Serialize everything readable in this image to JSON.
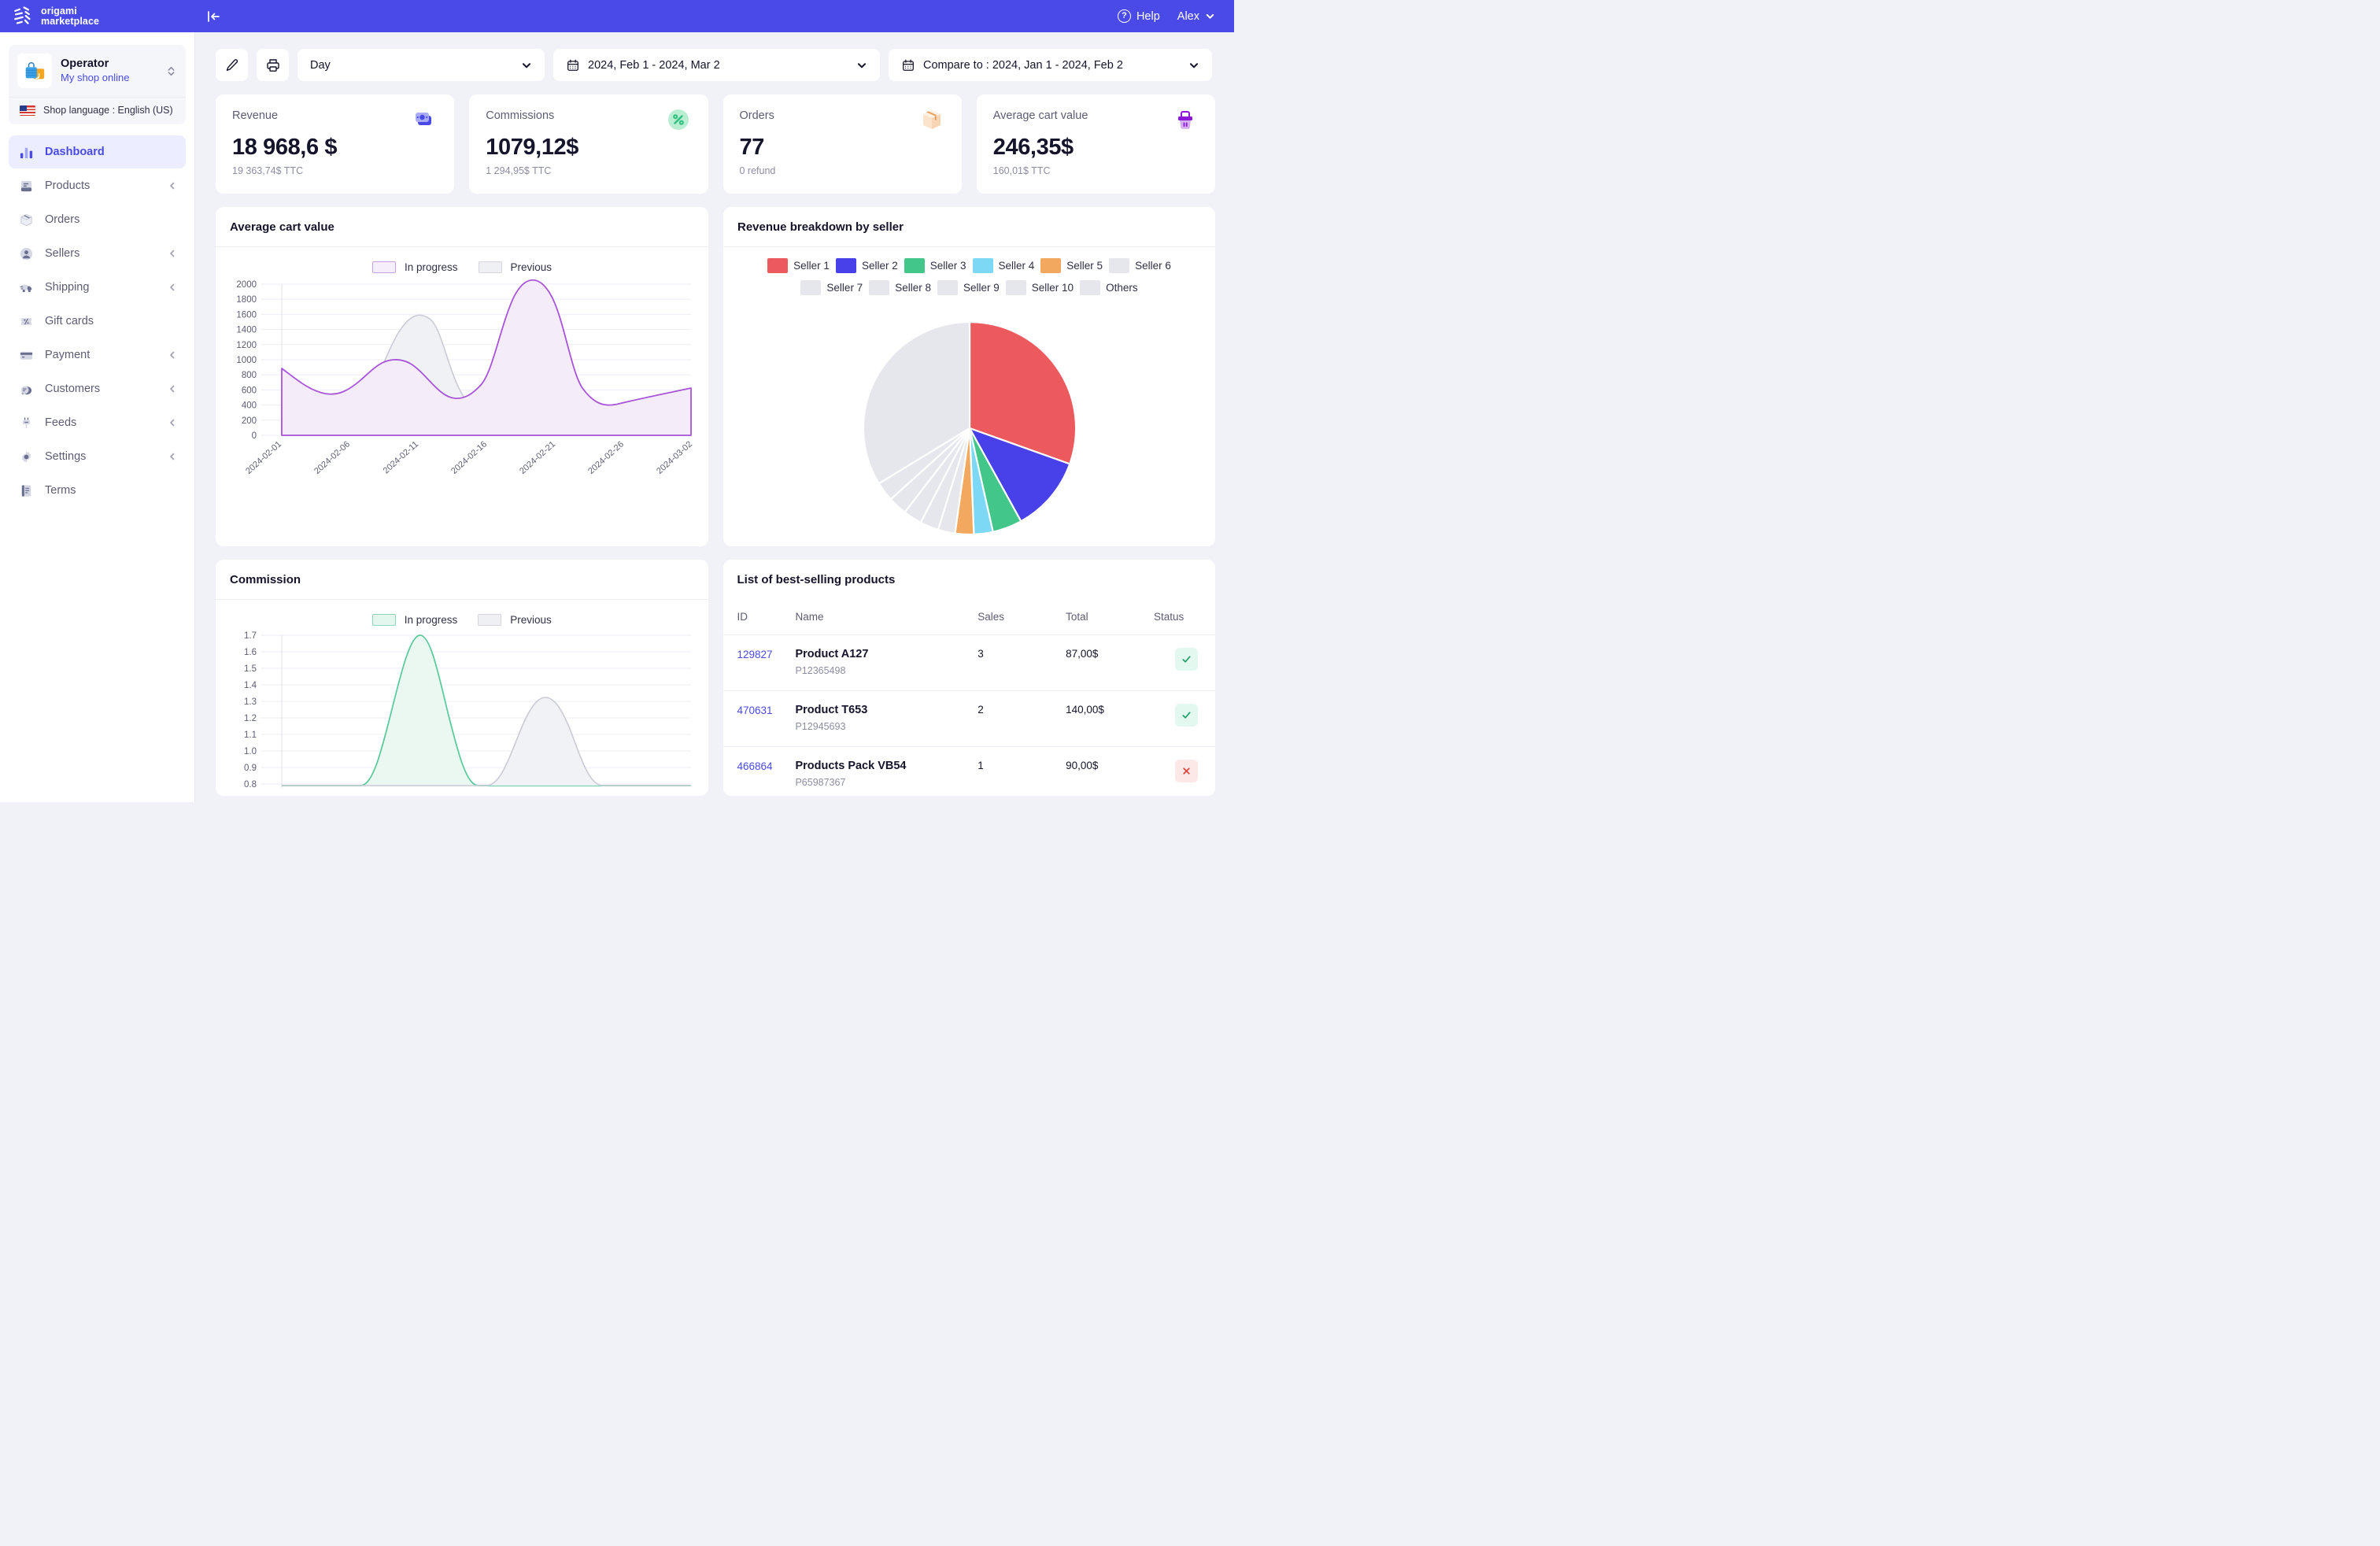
{
  "topbar": {
    "brand_line1": "origami",
    "brand_line2": "marketplace",
    "collapse_icon": "collapse-sidebar-icon",
    "help_label": "Help",
    "help_icon": "question-mark-icon",
    "user_name": "Alex",
    "user_caret_icon": "chevron-down-icon",
    "brand_bg": "#4a4ae8"
  },
  "sidebar": {
    "shop": {
      "name": "Operator",
      "subtitle": "My shop online",
      "avatar_icon": "shopping-bag-icon",
      "switch_icon": "chevron-up-down-icon",
      "language_label": "Shop language : English (US)",
      "flag_icon": "us-flag-icon"
    },
    "items": [
      {
        "label": "Dashboard",
        "icon": "bar-chart-icon",
        "active": true,
        "expandable": false
      },
      {
        "label": "Products",
        "icon": "book-icon",
        "active": false,
        "expandable": true
      },
      {
        "label": "Orders",
        "icon": "box-icon",
        "active": false,
        "expandable": false
      },
      {
        "label": "Sellers",
        "icon": "user-icon",
        "active": false,
        "expandable": true
      },
      {
        "label": "Shipping",
        "icon": "truck-icon",
        "active": false,
        "expandable": true
      },
      {
        "label": "Gift cards",
        "icon": "percent-tag-icon",
        "active": false,
        "expandable": false
      },
      {
        "label": "Payment",
        "icon": "credit-card-icon",
        "active": false,
        "expandable": true
      },
      {
        "label": "Customers",
        "icon": "chat-bubble-icon",
        "active": false,
        "expandable": true
      },
      {
        "label": "Feeds",
        "icon": "plug-icon",
        "active": false,
        "expandable": true
      },
      {
        "label": "Settings",
        "icon": "gear-icon",
        "active": false,
        "expandable": true
      },
      {
        "label": "Terms",
        "icon": "document-icon",
        "active": false,
        "expandable": false
      }
    ]
  },
  "toolbar": {
    "edit_icon": "pencil-icon",
    "print_icon": "printer-icon",
    "granularity_value": "Day",
    "granularity_caret": "chevron-down-icon",
    "date_range_value": "2024, Feb 1 - 2024, Mar 2",
    "date_range_icon": "calendar-icon",
    "compare_value": "Compare to : 2024, Jan 1 - 2024, Feb 2",
    "compare_icon": "calendar-icon"
  },
  "stats": [
    {
      "title": "Revenue",
      "value": "18 968,6 $",
      "sub": "19 363,74$ TTC",
      "icon": "money-icon",
      "icon_color": "#4a4ae8"
    },
    {
      "title": "Commissions",
      "value": "1079,12$",
      "sub": "1 294,95$ TTC",
      "icon": "percent-icon",
      "icon_color": "#2fbf7f"
    },
    {
      "title": "Orders",
      "value": "77",
      "sub": "0 refund",
      "icon": "package-icon",
      "icon_color": "#f0a868"
    },
    {
      "title": "Average cart value",
      "value": "246,35$",
      "sub": "160,01$ TTC",
      "icon": "basket-icon",
      "icon_color": "#8b17d9"
    }
  ],
  "panels": {
    "avg_cart": {
      "title": "Average cart value"
    },
    "revenue_breakdown": {
      "title": "Revenue breakdown by seller"
    },
    "commission": {
      "title": "Commission"
    },
    "best_sellers": {
      "title": "List of best-selling products"
    }
  },
  "legend": {
    "in_progress": "In progress",
    "previous": "Previous",
    "in_progress_color": "#f7eefc",
    "in_progress_border": "#c9a3e0",
    "previous_color": "#eff0f4",
    "previous_border": "#d3d5df"
  },
  "table": {
    "headers": [
      "ID",
      "Name",
      "Sales",
      "Total",
      "Status"
    ],
    "rows": [
      {
        "id": "129827",
        "name": "Product A127",
        "sku": "P12365498",
        "sales": "3",
        "total": "87,00$",
        "status": "ok",
        "status_icon": "check-icon"
      },
      {
        "id": "470631",
        "name": "Product T653",
        "sku": "P12945693",
        "sales": "2",
        "total": "140,00$",
        "status": "ok",
        "status_icon": "check-icon"
      },
      {
        "id": "466864",
        "name": "Products Pack VB54",
        "sku": "P65987367",
        "sales": "1",
        "total": "90,00$",
        "status": "no",
        "status_icon": "cross-icon"
      }
    ]
  },
  "chart_data": [
    {
      "id": "avg_cart_chart",
      "type": "area",
      "title": "Average cart value",
      "xlabel": "",
      "ylabel": "",
      "ylim": [
        0,
        2000
      ],
      "yticks": [
        0,
        200,
        400,
        600,
        800,
        1000,
        1200,
        1400,
        1600,
        1800,
        2000
      ],
      "grid": true,
      "legend_position": "top-center",
      "x": [
        "2024-02-01",
        "2024-02-06",
        "2024-02-11",
        "2024-02-16",
        "2024-02-21",
        "2024-02-26",
        "2024-03-02"
      ],
      "xtick_labels": [
        "2024-02-01",
        "2024-02-06",
        "2024-02-11",
        "2024-02-16",
        "2024-02-21",
        "2024-02-26",
        "2024-03-02"
      ],
      "series": [
        {
          "name": "In progress",
          "color": "#a855d8",
          "values": [
            900,
            630,
            550,
            700,
            990,
            940,
            600,
            470,
            520,
            1300,
            2000,
            1480,
            520,
            330,
            380,
            430
          ]
        },
        {
          "name": "Previous",
          "color": "#c9cbd6",
          "values": [
            480,
            300,
            240,
            300,
            900,
            1420,
            1100,
            380,
            250,
            430,
            660,
            600,
            350,
            230,
            330,
            560
          ]
        }
      ]
    },
    {
      "id": "revenue_by_seller_pie",
      "type": "pie",
      "title": "Revenue breakdown by seller",
      "legend_position": "top",
      "labels": [
        "Seller 1",
        "Seller 2",
        "Seller 3",
        "Seller 4",
        "Seller 5",
        "Seller 6",
        "Seller 7",
        "Seller 8",
        "Seller 9",
        "Seller 10",
        "Others"
      ],
      "colors": [
        "#ec5a5e",
        "#4840e8",
        "#43c68a",
        "#7dd8f5",
        "#f2a95f",
        "#e6e7ed",
        "#e6e7ed",
        "#e6e7ed",
        "#e6e7ed",
        "#e6e7ed",
        "#e6e7ed"
      ],
      "values": [
        25.5,
        11.5,
        6.0,
        4.2,
        4.0,
        3.0,
        2.6,
        2.4,
        2.2,
        2.0,
        36.6
      ]
    },
    {
      "id": "commission_chart",
      "type": "area",
      "title": "Commission",
      "ylim": [
        0.8,
        1.7
      ],
      "yticks": [
        0.8,
        0.9,
        1.0,
        1.1,
        1.2,
        1.3,
        1.4,
        1.5,
        1.6,
        1.7
      ],
      "grid": true,
      "legend_position": "top-center",
      "series": [
        {
          "name": "In progress",
          "color": "#58c99a",
          "values": [
            0.8,
            0.8,
            0.8,
            0.8,
            1.7,
            0.8,
            0.8,
            0.8,
            0.85,
            0.8,
            0.8
          ]
        },
        {
          "name": "Previous",
          "color": "#c9cbd6",
          "values": [
            0.8,
            0.8,
            0.8,
            0.8,
            0.8,
            0.8,
            0.8,
            1.25,
            0.8,
            0.8,
            0.8
          ]
        }
      ]
    }
  ]
}
